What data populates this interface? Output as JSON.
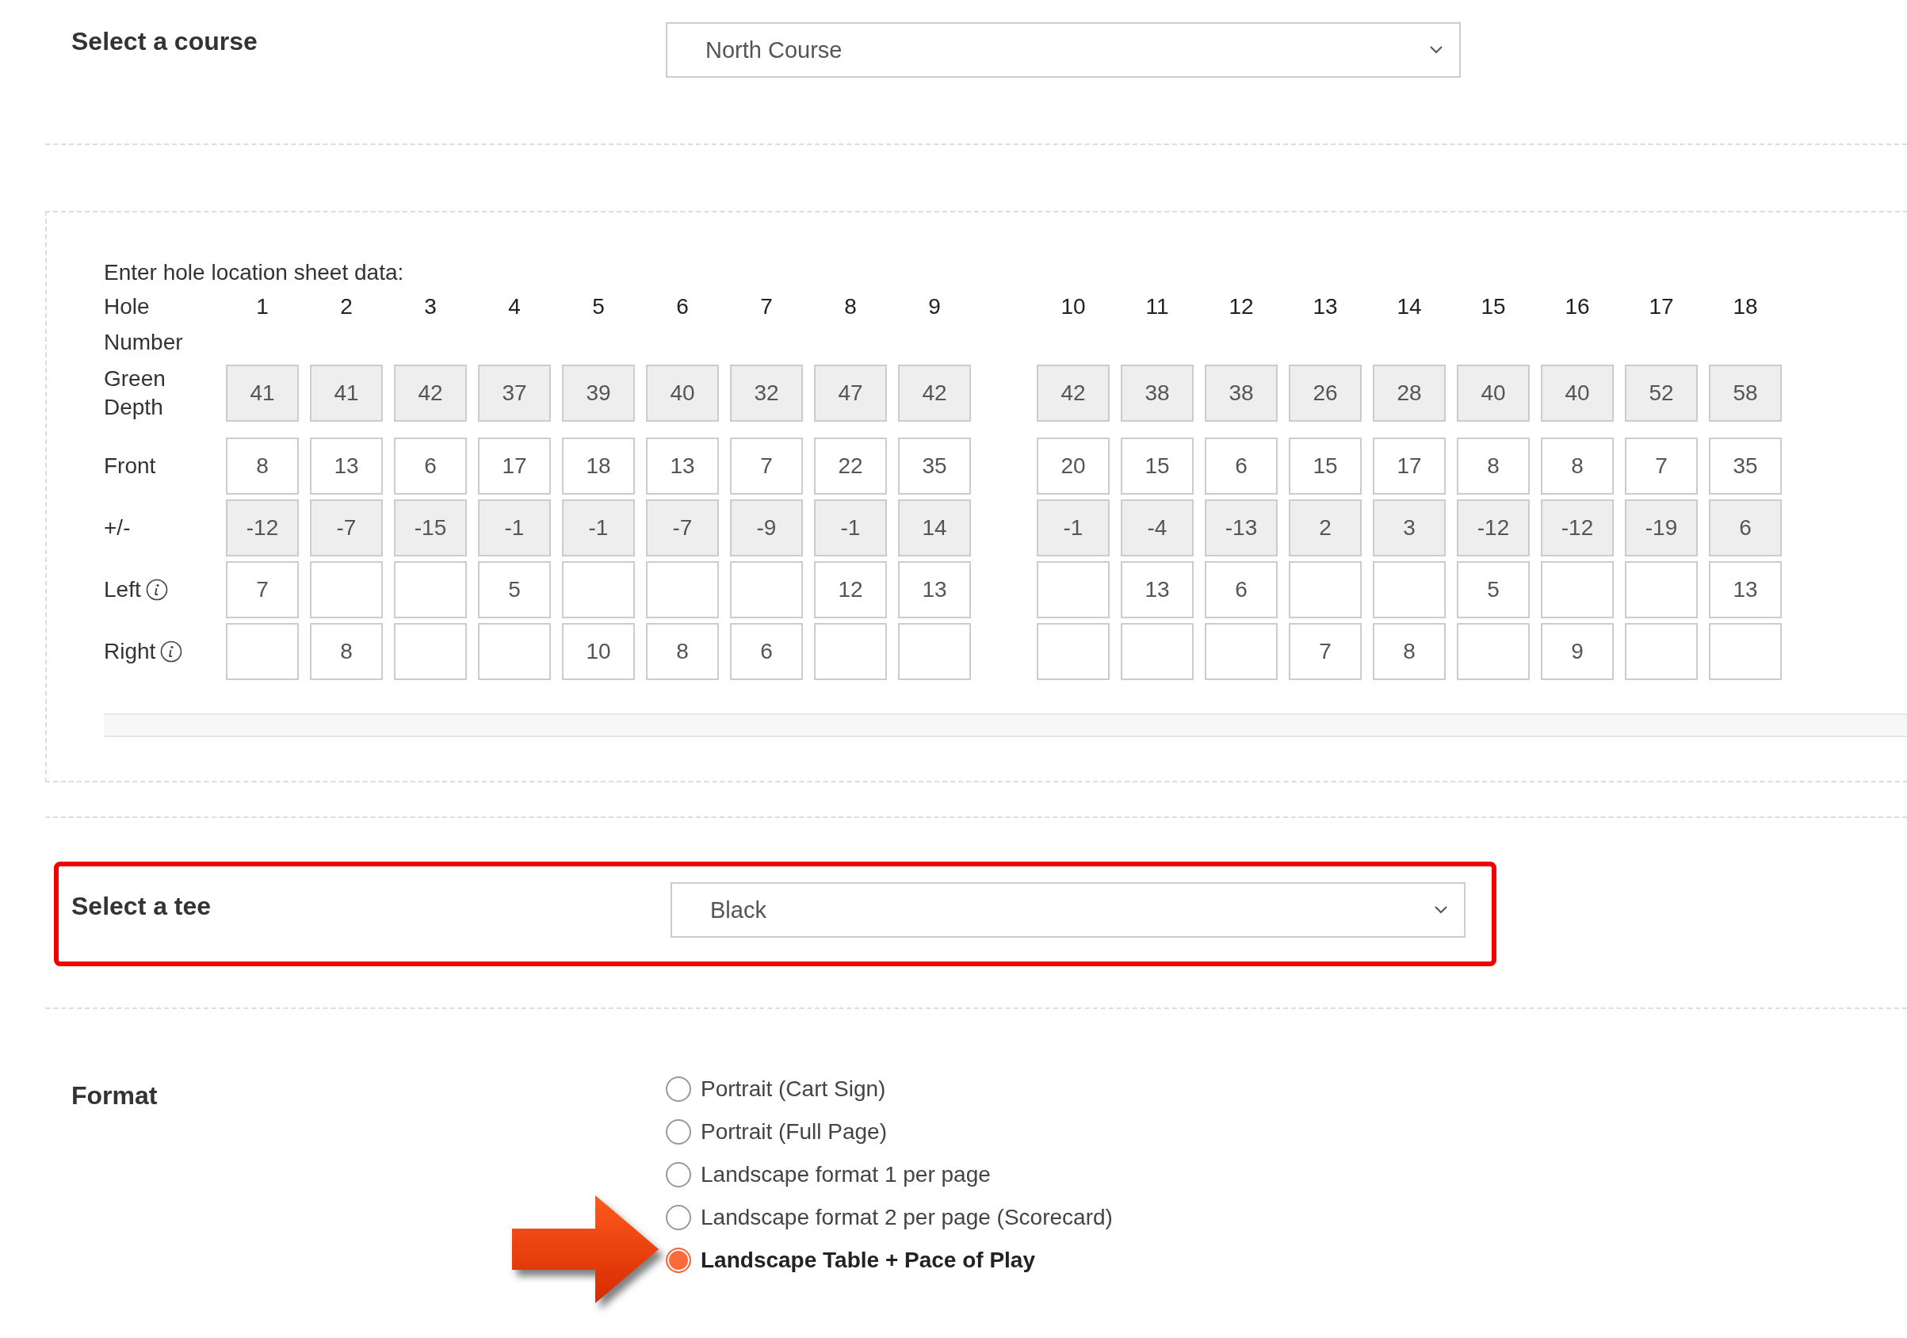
{
  "course": {
    "label": "Select a course",
    "value": "North Course"
  },
  "sheet": {
    "title": "Enter hole location sheet data:",
    "header_label": "Hole Number",
    "holes": [
      "1",
      "2",
      "3",
      "4",
      "5",
      "6",
      "7",
      "8",
      "9",
      "10",
      "11",
      "12",
      "13",
      "14",
      "15",
      "16",
      "17",
      "18"
    ],
    "rows": [
      {
        "label": "Green Depth",
        "kind": "readonly",
        "info": false,
        "cells": [
          {
            "filled": true,
            "value": "41"
          },
          {
            "filled": true,
            "value": "41"
          },
          {
            "filled": true,
            "value": "42"
          },
          {
            "filled": true,
            "value": "37"
          },
          {
            "filled": true,
            "value": "39"
          },
          {
            "filled": true,
            "value": "40"
          },
          {
            "filled": true,
            "value": "32"
          },
          {
            "filled": true,
            "value": "47"
          },
          {
            "filled": true,
            "value": "42"
          },
          {
            "filled": true,
            "value": "42"
          },
          {
            "filled": true,
            "value": "38"
          },
          {
            "filled": true,
            "value": "38"
          },
          {
            "filled": true,
            "value": "26"
          },
          {
            "filled": true,
            "value": "28"
          },
          {
            "filled": true,
            "value": "40"
          },
          {
            "filled": true,
            "value": "40"
          },
          {
            "filled": true,
            "value": "52"
          },
          {
            "filled": true,
            "value": "58"
          }
        ]
      },
      {
        "label": "Front",
        "kind": "input",
        "info": false,
        "cells": [
          {
            "filled": true,
            "value": "8"
          },
          {
            "filled": true,
            "value": "13"
          },
          {
            "filled": true,
            "value": "6"
          },
          {
            "filled": true,
            "value": "17"
          },
          {
            "filled": true,
            "value": "18"
          },
          {
            "filled": true,
            "value": "13"
          },
          {
            "filled": true,
            "value": "7"
          },
          {
            "filled": true,
            "value": "22"
          },
          {
            "filled": true,
            "value": "35"
          },
          {
            "filled": true,
            "value": "20"
          },
          {
            "filled": true,
            "value": "15"
          },
          {
            "filled": true,
            "value": "6"
          },
          {
            "filled": true,
            "value": "15"
          },
          {
            "filled": true,
            "value": "17"
          },
          {
            "filled": true,
            "value": "8"
          },
          {
            "filled": true,
            "value": "8"
          },
          {
            "filled": true,
            "value": "7"
          },
          {
            "filled": true,
            "value": "35"
          }
        ]
      },
      {
        "label": "+/-",
        "kind": "readonly",
        "info": false,
        "cells": [
          {
            "filled": true,
            "value": "-12"
          },
          {
            "filled": true,
            "value": "-7"
          },
          {
            "filled": true,
            "value": "-15"
          },
          {
            "filled": true,
            "value": "-1"
          },
          {
            "filled": true,
            "value": "-1"
          },
          {
            "filled": true,
            "value": "-7"
          },
          {
            "filled": true,
            "value": "-9"
          },
          {
            "filled": true,
            "value": "-1"
          },
          {
            "filled": true,
            "value": "14"
          },
          {
            "filled": true,
            "value": "-1"
          },
          {
            "filled": true,
            "value": "-4"
          },
          {
            "filled": true,
            "value": "-13"
          },
          {
            "filled": true,
            "value": "2"
          },
          {
            "filled": true,
            "value": "3"
          },
          {
            "filled": true,
            "value": "-12"
          },
          {
            "filled": true,
            "value": "-12"
          },
          {
            "filled": true,
            "value": "-19"
          },
          {
            "filled": true,
            "value": "6"
          }
        ]
      },
      {
        "label": "Left",
        "kind": "input",
        "info": true,
        "cells": [
          {
            "filled": true,
            "value": "7"
          },
          {
            "filled": false
          },
          {
            "filled": false
          },
          {
            "filled": true,
            "value": "5"
          },
          {
            "filled": false
          },
          {
            "filled": false
          },
          {
            "filled": false
          },
          {
            "filled": true,
            "value": "12"
          },
          {
            "filled": true,
            "value": "13"
          },
          {
            "filled": false
          },
          {
            "filled": true,
            "value": "13"
          },
          {
            "filled": true,
            "value": "6"
          },
          {
            "filled": false
          },
          {
            "filled": false
          },
          {
            "filled": true,
            "value": "5"
          },
          {
            "filled": false
          },
          {
            "filled": false
          },
          {
            "filled": true,
            "value": "13"
          }
        ]
      },
      {
        "label": "Right",
        "kind": "input",
        "info": true,
        "cells": [
          {
            "filled": false
          },
          {
            "filled": true,
            "value": "8"
          },
          {
            "filled": false
          },
          {
            "filled": false
          },
          {
            "filled": true,
            "value": "10"
          },
          {
            "filled": true,
            "value": "8"
          },
          {
            "filled": true,
            "value": "6"
          },
          {
            "filled": false
          },
          {
            "filled": false
          },
          {
            "filled": false
          },
          {
            "filled": false
          },
          {
            "filled": false
          },
          {
            "filled": true,
            "value": "7"
          },
          {
            "filled": true,
            "value": "8"
          },
          {
            "filled": false
          },
          {
            "filled": true,
            "value": "9"
          },
          {
            "filled": false
          },
          {
            "filled": false
          }
        ]
      }
    ]
  },
  "tee": {
    "label": "Select a tee",
    "value": "Black",
    "highlighted": true
  },
  "format": {
    "label": "Format",
    "options": [
      {
        "label": "Portrait (Cart Sign)",
        "selected": false
      },
      {
        "label": "Portrait (Full Page)",
        "selected": false
      },
      {
        "label": "Landscape format 1 per page",
        "selected": false
      },
      {
        "label": "Landscape format 2 per page (Scorecard)",
        "selected": false
      },
      {
        "label": "Landscape Table + Pace of Play",
        "selected": true
      }
    ]
  }
}
